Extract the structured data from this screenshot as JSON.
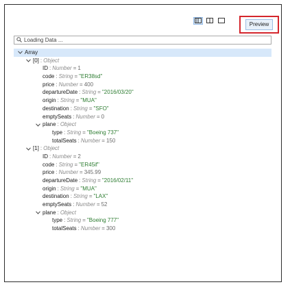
{
  "toolbar": {
    "icons": [
      "split-vertical-icon",
      "split-horizontal-icon",
      "single-pane-icon"
    ],
    "preview_label": "Preview",
    "accent": "#d4252c"
  },
  "search": {
    "placeholder": "Loading Data ..."
  },
  "tree": {
    "root": {
      "label": "Array"
    },
    "items": [
      {
        "label": "[0]",
        "type": "Object",
        "fields": [
          {
            "key": "ID",
            "type": "Number",
            "value": "1",
            "kind": "num"
          },
          {
            "key": "code",
            "type": "String",
            "value": "\"ER38sd\"",
            "kind": "str"
          },
          {
            "key": "price",
            "type": "Number",
            "value": "400",
            "kind": "num"
          },
          {
            "key": "departureDate",
            "type": "String",
            "value": "\"2016/03/20\"",
            "kind": "str"
          },
          {
            "key": "origin",
            "type": "String",
            "value": "\"MUA\"",
            "kind": "str"
          },
          {
            "key": "destination",
            "type": "String",
            "value": "\"SFO\"",
            "kind": "str"
          },
          {
            "key": "emptySeats",
            "type": "Number",
            "value": "0",
            "kind": "num"
          }
        ],
        "plane": {
          "key": "plane",
          "type": "Object",
          "fields": [
            {
              "key": "type",
              "type": "String",
              "value": "\"Boeing 737\"",
              "kind": "str"
            },
            {
              "key": "totalSeats",
              "type": "Number",
              "value": "150",
              "kind": "num"
            }
          ]
        }
      },
      {
        "label": "[1]",
        "type": "Object",
        "fields": [
          {
            "key": "ID",
            "type": "Number",
            "value": "2",
            "kind": "num"
          },
          {
            "key": "code",
            "type": "String",
            "value": "\"ER45if\"",
            "kind": "str"
          },
          {
            "key": "price",
            "type": "Number",
            "value": "345.99",
            "kind": "num"
          },
          {
            "key": "departureDate",
            "type": "String",
            "value": "\"2016/02/11\"",
            "kind": "str"
          },
          {
            "key": "origin",
            "type": "String",
            "value": "\"MUA\"",
            "kind": "str"
          },
          {
            "key": "destination",
            "type": "String",
            "value": "\"LAX\"",
            "kind": "str"
          },
          {
            "key": "emptySeats",
            "type": "Number",
            "value": "52",
            "kind": "num"
          }
        ],
        "plane": {
          "key": "plane",
          "type": "Object",
          "fields": [
            {
              "key": "type",
              "type": "String",
              "value": "\"Boeing 777\"",
              "kind": "str"
            },
            {
              "key": "totalSeats",
              "type": "Number",
              "value": "300",
              "kind": "num"
            }
          ]
        }
      }
    ]
  }
}
